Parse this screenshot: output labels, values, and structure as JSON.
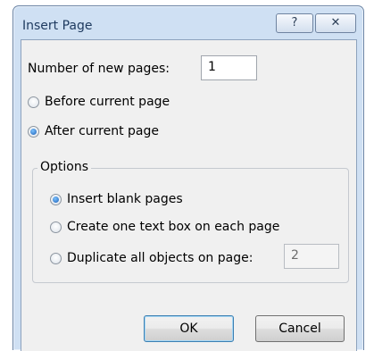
{
  "dialog": {
    "title": "Insert Page",
    "help_glyph": "?",
    "close_glyph": "✕"
  },
  "pages_field": {
    "label": "Number of new pages:",
    "value": "1"
  },
  "position": {
    "before_label": "Before current page",
    "after_label": "After current page",
    "selected": "after"
  },
  "options": {
    "group_label": "Options",
    "insert_blank_label": "Insert blank pages",
    "text_box_label": "Create one text box on each page",
    "duplicate_label": "Duplicate all objects on page:",
    "duplicate_value": "2",
    "selected": "insert_blank"
  },
  "buttons": {
    "ok_label": "OK",
    "cancel_label": "Cancel"
  },
  "colors": {
    "frame": "#cfe0f3",
    "client": "#f0f0f0",
    "radio_selected": "#1c5fb5"
  },
  "icons": [
    "help-icon",
    "close-icon"
  ]
}
